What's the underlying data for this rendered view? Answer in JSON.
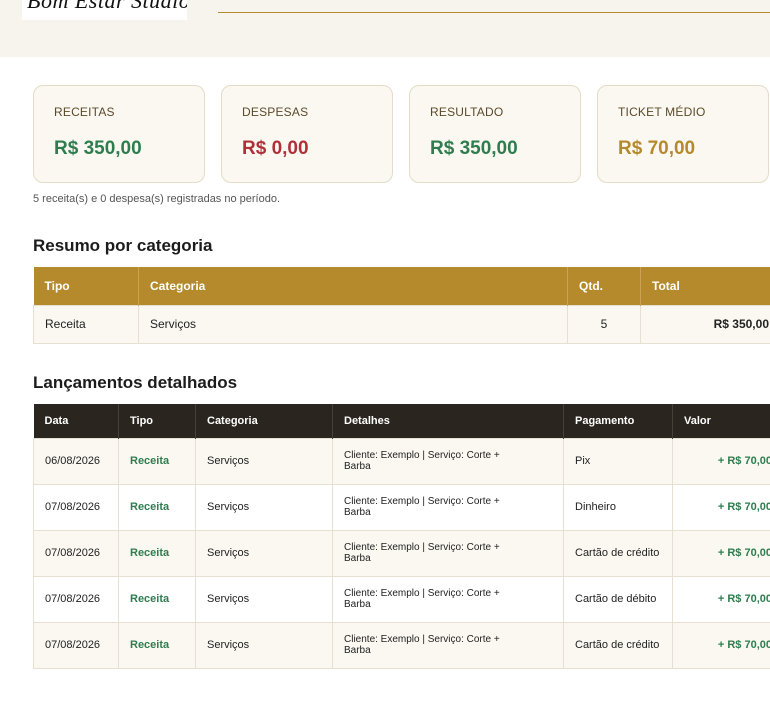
{
  "header": {
    "logo_text": "Bom Estar Studio"
  },
  "cards": [
    {
      "label": "RECEITAS",
      "value": "R$ 350,00",
      "color": "#2e7d4f"
    },
    {
      "label": "DESPESAS",
      "value": "R$ 0,00",
      "color": "#b0303a"
    },
    {
      "label": "RESULTADO",
      "value": "R$ 350,00",
      "color": "#2e7d4f"
    },
    {
      "label": "TICKET MÉDIO",
      "value": "R$ 70,00",
      "color": "#b58a2c"
    }
  ],
  "note": "5 receita(s) e 0 despesa(s) registradas no período.",
  "summary": {
    "title": "Resumo por categoria",
    "headers": [
      "Tipo",
      "Categoria",
      "Qtd.",
      "Total"
    ],
    "rows": [
      {
        "tipo": "Receita",
        "categoria": "Serviços",
        "qtd": "5",
        "total": "R$ 350,00"
      }
    ]
  },
  "details": {
    "title": "Lançamentos detalhados",
    "headers": [
      "Data",
      "Tipo",
      "Categoria",
      "Detalhes",
      "Pagamento",
      "Valor"
    ],
    "rows": [
      {
        "data": "06/08/2026",
        "tipo": "Receita",
        "categoria": "Serviços",
        "detalhes": "Cliente: Exemplo | Serviço: Corte + Barba",
        "pagamento": "Pix",
        "valor": "+ R$ 70,00"
      },
      {
        "data": "07/08/2026",
        "tipo": "Receita",
        "categoria": "Serviços",
        "detalhes": "Cliente: Exemplo | Serviço: Corte + Barba",
        "pagamento": "Dinheiro",
        "valor": "+ R$ 70,00"
      },
      {
        "data": "07/08/2026",
        "tipo": "Receita",
        "categoria": "Serviços",
        "detalhes": "Cliente: Exemplo | Serviço: Corte + Barba",
        "pagamento": "Cartão de crédito",
        "valor": "+ R$ 70,00"
      },
      {
        "data": "07/08/2026",
        "tipo": "Receita",
        "categoria": "Serviços",
        "detalhes": "Cliente: Exemplo | Serviço: Corte + Barba",
        "pagamento": "Cartão de débito",
        "valor": "+ R$ 70,00"
      },
      {
        "data": "07/08/2026",
        "tipo": "Receita",
        "categoria": "Serviços",
        "detalhes": "Cliente: Exemplo | Serviço: Corte + Barba",
        "pagamento": "Cartão de crédito",
        "valor": "+ R$ 70,00"
      }
    ]
  }
}
